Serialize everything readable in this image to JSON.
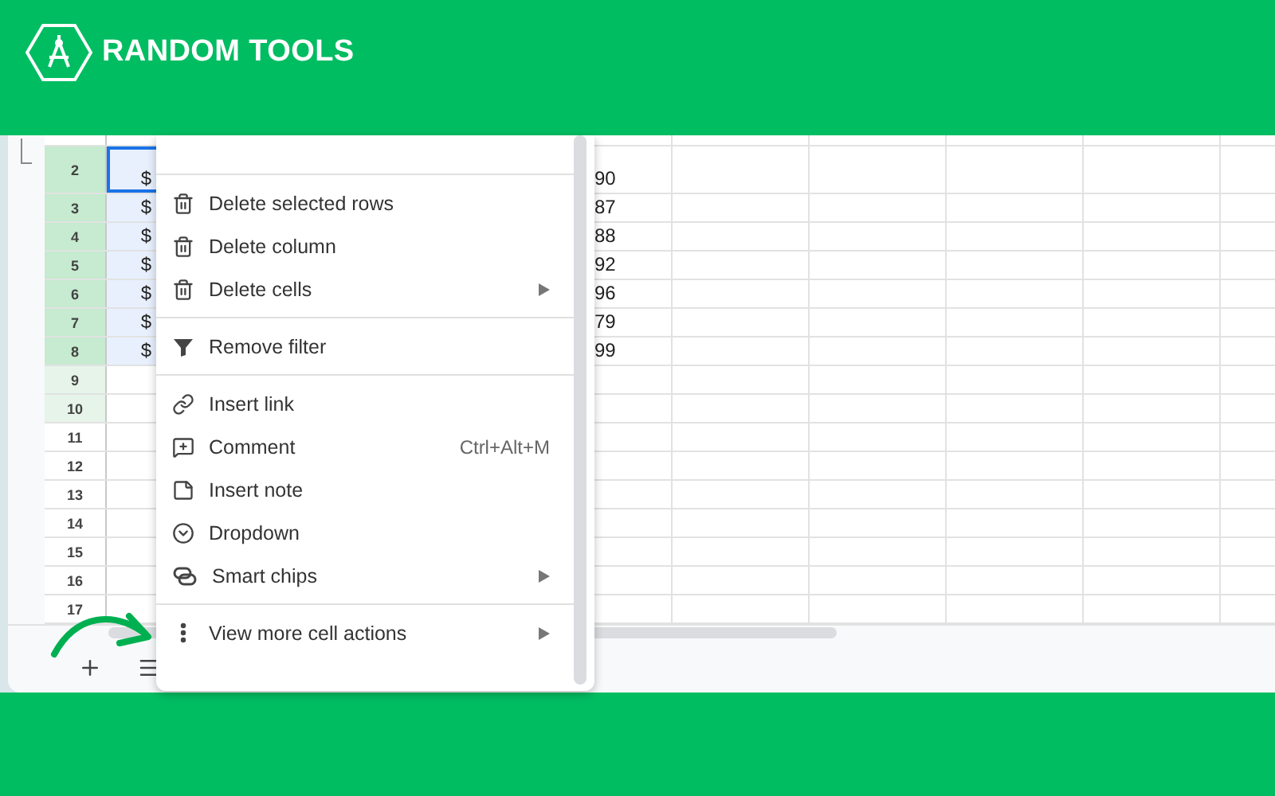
{
  "brand": {
    "name": "RANDOM TOOLS"
  },
  "sheet": {
    "rows": [
      {
        "number": "2",
        "selected": true,
        "in_filter": true,
        "tall": true,
        "col_b": "$",
        "col_c": "90"
      },
      {
        "number": "3",
        "selected": true,
        "in_filter": true,
        "tall": false,
        "col_b": "$",
        "col_c": "87"
      },
      {
        "number": "4",
        "selected": true,
        "in_filter": true,
        "tall": false,
        "col_b": "$",
        "col_c": "88"
      },
      {
        "number": "5",
        "selected": true,
        "in_filter": true,
        "tall": false,
        "col_b": "$",
        "col_c": "92"
      },
      {
        "number": "6",
        "selected": true,
        "in_filter": true,
        "tall": false,
        "col_b": "$",
        "col_c": "96"
      },
      {
        "number": "7",
        "selected": true,
        "in_filter": true,
        "tall": false,
        "col_b": "$",
        "col_c": "79"
      },
      {
        "number": "8",
        "selected": true,
        "in_filter": true,
        "tall": false,
        "col_b": "$",
        "col_c": "99"
      },
      {
        "number": "9",
        "selected": false,
        "in_filter": true,
        "tall": false
      },
      {
        "number": "10",
        "selected": false,
        "in_filter": true,
        "tall": false
      },
      {
        "number": "11",
        "selected": false,
        "in_filter": false,
        "tall": false
      },
      {
        "number": "12",
        "selected": false,
        "in_filter": false,
        "tall": false
      },
      {
        "number": "13",
        "selected": false,
        "in_filter": false,
        "tall": false
      },
      {
        "number": "14",
        "selected": false,
        "in_filter": false,
        "tall": false
      },
      {
        "number": "15",
        "selected": false,
        "in_filter": false,
        "tall": false
      },
      {
        "number": "16",
        "selected": false,
        "in_filter": false,
        "tall": false
      },
      {
        "number": "17",
        "selected": false,
        "in_filter": false,
        "tall": false
      }
    ]
  },
  "context_menu": {
    "groups": [
      [
        {
          "kind": "trash",
          "label": "Delete selected rows",
          "submenu": false
        },
        {
          "kind": "trash",
          "label": "Delete column",
          "submenu": false
        },
        {
          "kind": "trash",
          "label": "Delete cells",
          "submenu": true
        }
      ],
      [
        {
          "kind": "filter",
          "label": "Remove filter",
          "submenu": false
        }
      ],
      [
        {
          "kind": "link",
          "label": "Insert link",
          "submenu": false
        },
        {
          "kind": "comment",
          "label": "Comment",
          "shortcut": "Ctrl+Alt+M",
          "submenu": false
        },
        {
          "kind": "note",
          "label": "Insert note",
          "submenu": false
        },
        {
          "kind": "dropdown",
          "label": "Dropdown",
          "submenu": false
        },
        {
          "kind": "chips",
          "label": "Smart chips",
          "submenu": true
        }
      ],
      [
        {
          "kind": "more",
          "label": "View more cell actions",
          "submenu": true
        }
      ]
    ]
  }
}
